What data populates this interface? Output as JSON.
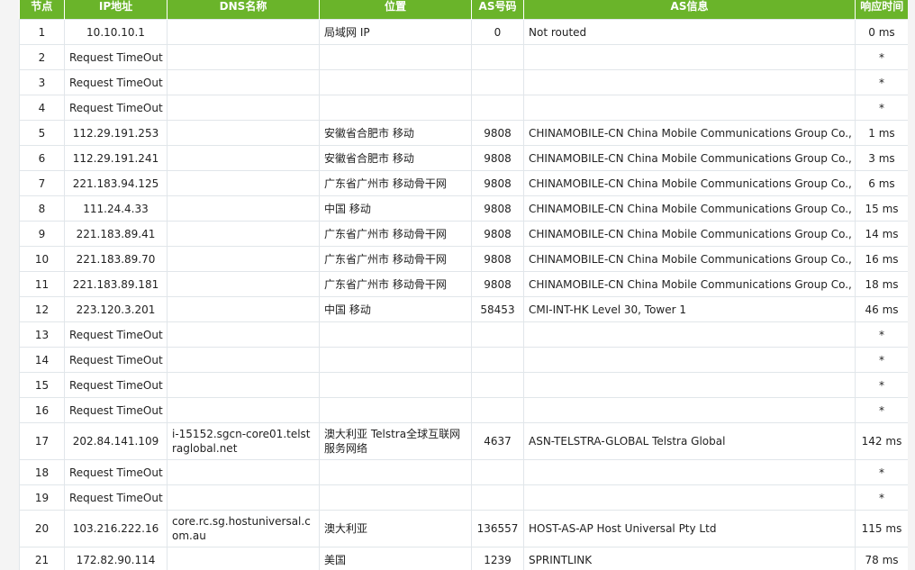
{
  "columns": [
    "节点",
    "IP地址",
    "DNS名称",
    "位置",
    "AS号码",
    "AS信息",
    "响应时间"
  ],
  "rows": [
    {
      "node": "1",
      "ip": "10.10.10.1",
      "dns": "",
      "location": "局域网 IP",
      "asn": "0",
      "asinfo": "Not routed",
      "time": "0 ms"
    },
    {
      "node": "2",
      "ip": "Request TimeOut",
      "dns": "",
      "location": "",
      "asn": "",
      "asinfo": "",
      "time": "*"
    },
    {
      "node": "3",
      "ip": "Request TimeOut",
      "dns": "",
      "location": "",
      "asn": "",
      "asinfo": "",
      "time": "*"
    },
    {
      "node": "4",
      "ip": "Request TimeOut",
      "dns": "",
      "location": "",
      "asn": "",
      "asinfo": "",
      "time": "*"
    },
    {
      "node": "5",
      "ip": "112.29.191.253",
      "dns": "",
      "location": "安徽省合肥市 移动",
      "asn": "9808",
      "asinfo": "CHINAMOBILE-CN China Mobile Communications Group Co., Ltd.",
      "time": "1 ms"
    },
    {
      "node": "6",
      "ip": "112.29.191.241",
      "dns": "",
      "location": "安徽省合肥市 移动",
      "asn": "9808",
      "asinfo": "CHINAMOBILE-CN China Mobile Communications Group Co., Ltd.",
      "time": "3 ms"
    },
    {
      "node": "7",
      "ip": "221.183.94.125",
      "dns": "",
      "location": "广东省广州市 移动骨干网",
      "asn": "9808",
      "asinfo": "CHINAMOBILE-CN China Mobile Communications Group Co., Ltd.",
      "time": "6 ms"
    },
    {
      "node": "8",
      "ip": "111.24.4.33",
      "dns": "",
      "location": "中国 移动",
      "asn": "9808",
      "asinfo": "CHINAMOBILE-CN China Mobile Communications Group Co., Ltd.",
      "time": "15 ms"
    },
    {
      "node": "9",
      "ip": "221.183.89.41",
      "dns": "",
      "location": "广东省广州市 移动骨干网",
      "asn": "9808",
      "asinfo": "CHINAMOBILE-CN China Mobile Communications Group Co., Ltd.",
      "time": "14 ms"
    },
    {
      "node": "10",
      "ip": "221.183.89.70",
      "dns": "",
      "location": "广东省广州市 移动骨干网",
      "asn": "9808",
      "asinfo": "CHINAMOBILE-CN China Mobile Communications Group Co., Ltd.",
      "time": "16 ms"
    },
    {
      "node": "11",
      "ip": "221.183.89.181",
      "dns": "",
      "location": "广东省广州市 移动骨干网",
      "asn": "9808",
      "asinfo": "CHINAMOBILE-CN China Mobile Communications Group Co., Ltd.",
      "time": "18 ms"
    },
    {
      "node": "12",
      "ip": "223.120.3.201",
      "dns": "",
      "location": "中国 移动",
      "asn": "58453",
      "asinfo": "CMI-INT-HK Level 30, Tower 1",
      "time": "46 ms"
    },
    {
      "node": "13",
      "ip": "Request TimeOut",
      "dns": "",
      "location": "",
      "asn": "",
      "asinfo": "",
      "time": "*"
    },
    {
      "node": "14",
      "ip": "Request TimeOut",
      "dns": "",
      "location": "",
      "asn": "",
      "asinfo": "",
      "time": "*"
    },
    {
      "node": "15",
      "ip": "Request TimeOut",
      "dns": "",
      "location": "",
      "asn": "",
      "asinfo": "",
      "time": "*"
    },
    {
      "node": "16",
      "ip": "Request TimeOut",
      "dns": "",
      "location": "",
      "asn": "",
      "asinfo": "",
      "time": "*"
    },
    {
      "node": "17",
      "ip": "202.84.141.109",
      "dns": "i-15152.sgcn-core01.telstraglobal.net",
      "location": "澳大利亚 Telstra全球互联网服务网络",
      "asn": "4637",
      "asinfo": "ASN-TELSTRA-GLOBAL Telstra Global",
      "time": "142 ms"
    },
    {
      "node": "18",
      "ip": "Request TimeOut",
      "dns": "",
      "location": "",
      "asn": "",
      "asinfo": "",
      "time": "*"
    },
    {
      "node": "19",
      "ip": "Request TimeOut",
      "dns": "",
      "location": "",
      "asn": "",
      "asinfo": "",
      "time": "*"
    },
    {
      "node": "20",
      "ip": "103.216.222.16",
      "dns": "core.rc.sg.hostuniversal.com.au",
      "location": "澳大利亚",
      "asn": "136557",
      "asinfo": "HOST-AS-AP Host Universal Pty Ltd",
      "time": "115 ms"
    },
    {
      "node": "21",
      "ip": "172.82.90.114",
      "dns": "",
      "location": "美国",
      "asn": "1239",
      "asinfo": "SPRINTLINK",
      "time": "78 ms"
    }
  ],
  "colors": {
    "header_bg": "#6ab42a",
    "header_text": "#ffffff",
    "grid_line": "#e1e6ea",
    "page_bg": "#f4f4f4"
  }
}
